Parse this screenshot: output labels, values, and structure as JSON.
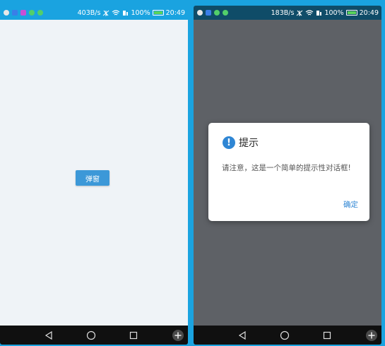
{
  "status_left": {
    "speed": "403B/s",
    "battery": "100%",
    "time": "20:49"
  },
  "status_right": {
    "speed": "183B/s",
    "battery": "100%",
    "time": "20:49"
  },
  "main": {
    "popup_button_label": "弹窗"
  },
  "dialog": {
    "title": "提示",
    "message": "请注意，这是一个简单的提示性对话框!",
    "confirm_label": "确定",
    "icon": "exclamation-circle-icon"
  },
  "navigation": {
    "back_icon": "triangle-back-icon",
    "home_icon": "circle-home-icon",
    "recent_icon": "square-recent-icon",
    "extra_icon": "plus-circle-icon"
  },
  "colors": {
    "accent": "#3c98d8",
    "dialog_accent": "#2f86d4",
    "status_bar_left": "#1aa3e0",
    "status_bar_right": "#0f4c68",
    "overlay": "#5e6166",
    "page_background": "#eff3f7"
  }
}
